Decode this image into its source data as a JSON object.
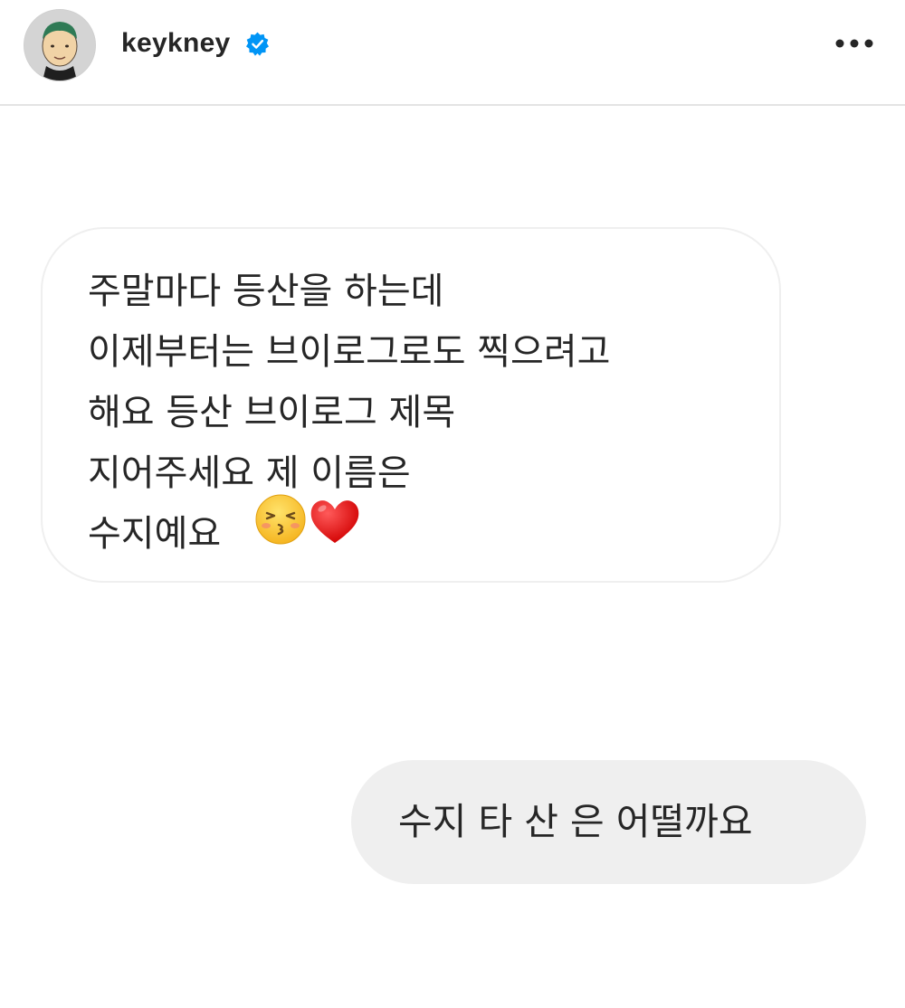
{
  "header": {
    "username": "keykney",
    "verified": true,
    "avatar_icon": "cartoon-avatar-icon",
    "verified_icon": "verified-badge-icon",
    "more_icon": "more-options-icon"
  },
  "conversation": {
    "received": {
      "text": "주말마다 등산을 하는데\n이제부터는 브이로그로도 찍으려고\n해요 등산 브이로그 제목\n지어주세요 제 이름은\n수지예요",
      "emojis": [
        "kissing-face-closed-eyes-icon",
        "red-heart-icon"
      ]
    },
    "sent": {
      "text": "수지 타 산 은 어떨까요"
    }
  },
  "colors": {
    "verified_blue": "#0095f6",
    "sent_bubble": "#efefef",
    "text": "#262626"
  }
}
